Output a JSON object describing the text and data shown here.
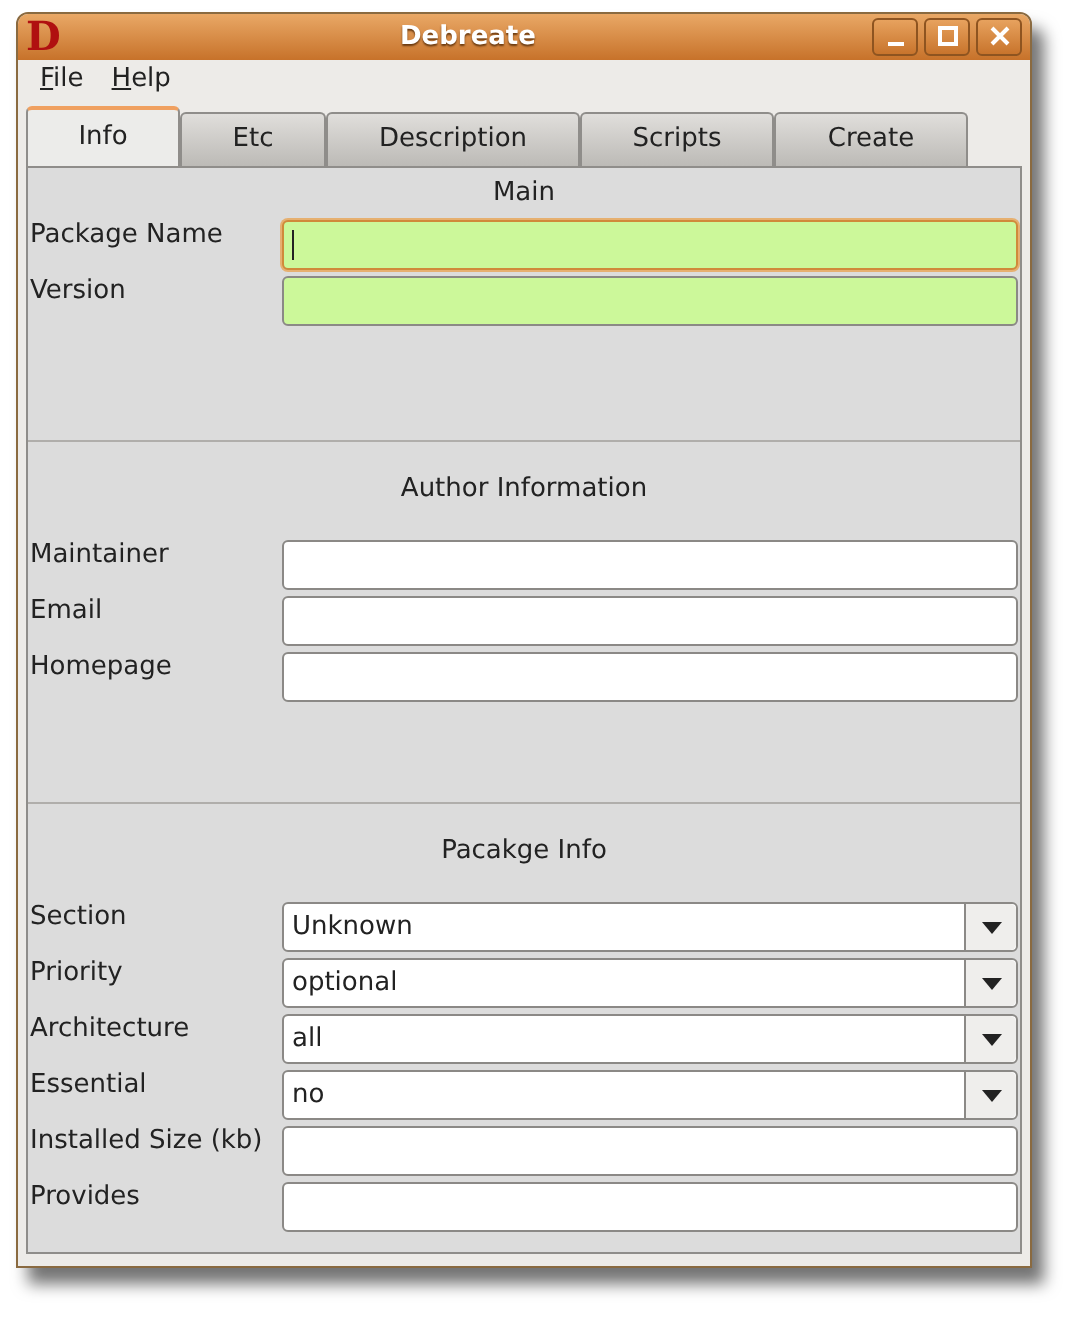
{
  "window": {
    "title": "Debreate",
    "logo": "D"
  },
  "menu": [
    "File",
    "Help"
  ],
  "tabs": [
    {
      "label": "Info",
      "selected": true
    },
    {
      "label": "Etc",
      "selected": false
    },
    {
      "label": "Description",
      "selected": false
    },
    {
      "label": "Scripts",
      "selected": false
    },
    {
      "label": "Create",
      "selected": false
    }
  ],
  "sections": [
    {
      "title": "Main",
      "fields": [
        {
          "label": "Package Name",
          "kind": "text",
          "required": true,
          "focused": true
        },
        {
          "label": "Version",
          "kind": "text",
          "required": true,
          "focused": false
        }
      ]
    },
    {
      "title": "Author Information",
      "fields": [
        {
          "label": "Maintainer",
          "kind": "text",
          "required": false,
          "focused": false
        },
        {
          "label": "Email",
          "kind": "text",
          "required": false,
          "focused": false
        },
        {
          "label": "Homepage",
          "kind": "text",
          "required": false,
          "focused": false
        }
      ]
    },
    {
      "title": "Pacakge Info",
      "fields": [
        {
          "label": "Section",
          "kind": "combo",
          "value": "Unknown"
        },
        {
          "label": "Priority",
          "kind": "combo",
          "value": "optional"
        },
        {
          "label": "Architecture",
          "kind": "combo",
          "value": "all"
        },
        {
          "label": "Essential",
          "kind": "combo",
          "value": "no"
        },
        {
          "label": "Installed Size (kb)",
          "kind": "text",
          "required": false,
          "focused": false
        },
        {
          "label": "Provides",
          "kind": "text",
          "required": false,
          "focused": false
        }
      ]
    }
  ]
}
